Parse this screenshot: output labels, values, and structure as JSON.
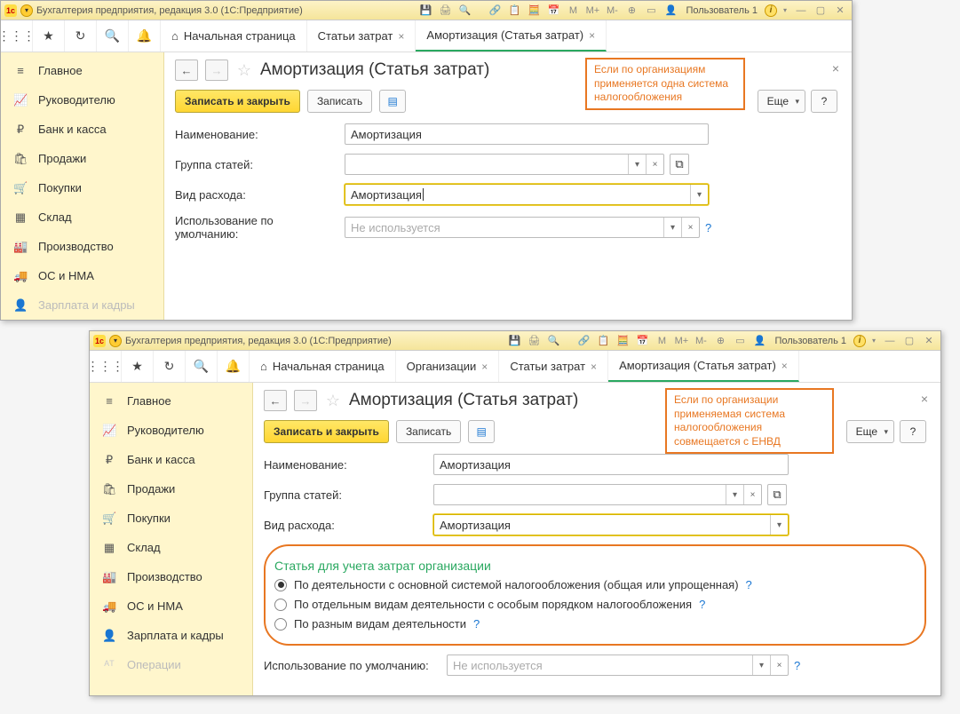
{
  "titlebar": {
    "logo": "1c",
    "title": "Бухгалтерия предприятия, редакция 3.0  (1С:Предприятие)",
    "user": "Пользователь 1",
    "mem": [
      "M",
      "M+",
      "M-"
    ]
  },
  "tabs1": {
    "home": "Начальная страница",
    "t1": "Статьи затрат",
    "t2": "Амортизация (Статья затрат)"
  },
  "tabs2": {
    "home": "Начальная страница",
    "t1": "Организации",
    "t2": "Статьи затрат",
    "t3": "Амортизация (Статья затрат)"
  },
  "sidebar": {
    "items": [
      {
        "label": "Главное"
      },
      {
        "label": "Руководителю"
      },
      {
        "label": "Банк и касса"
      },
      {
        "label": "Продажи"
      },
      {
        "label": "Покупки"
      },
      {
        "label": "Склад"
      },
      {
        "label": "Производство"
      },
      {
        "label": "ОС и НМА"
      },
      {
        "label": "Зарплата и кадры"
      },
      {
        "label": "Операции"
      }
    ]
  },
  "page": {
    "title": "Амортизация (Статья затрат)",
    "save_close": "Записать и закрыть",
    "save": "Записать",
    "more": "Еще",
    "help": "?",
    "labels": {
      "name": "Наименование:",
      "group": "Группа статей:",
      "kind": "Вид расхода:",
      "usage": "Использование по умолчанию:"
    },
    "values": {
      "name": "Амортизация",
      "group": "",
      "kind": "Амортизация",
      "usage_ph": "Не используется"
    },
    "section": "Статья для учета затрат организации",
    "radios": {
      "r1": "По деятельности с основной системой налогообложения (общая или упрощенная)",
      "r2": "По отдельным видам деятельности с особым порядком налогообложения",
      "r3": "По разным видам деятельности"
    }
  },
  "annotations": {
    "a1": "Если по организациям применяется одна система налогообложения",
    "a2": "Если по организации применяемая система налогообложения совмещается с ЕНВД"
  }
}
